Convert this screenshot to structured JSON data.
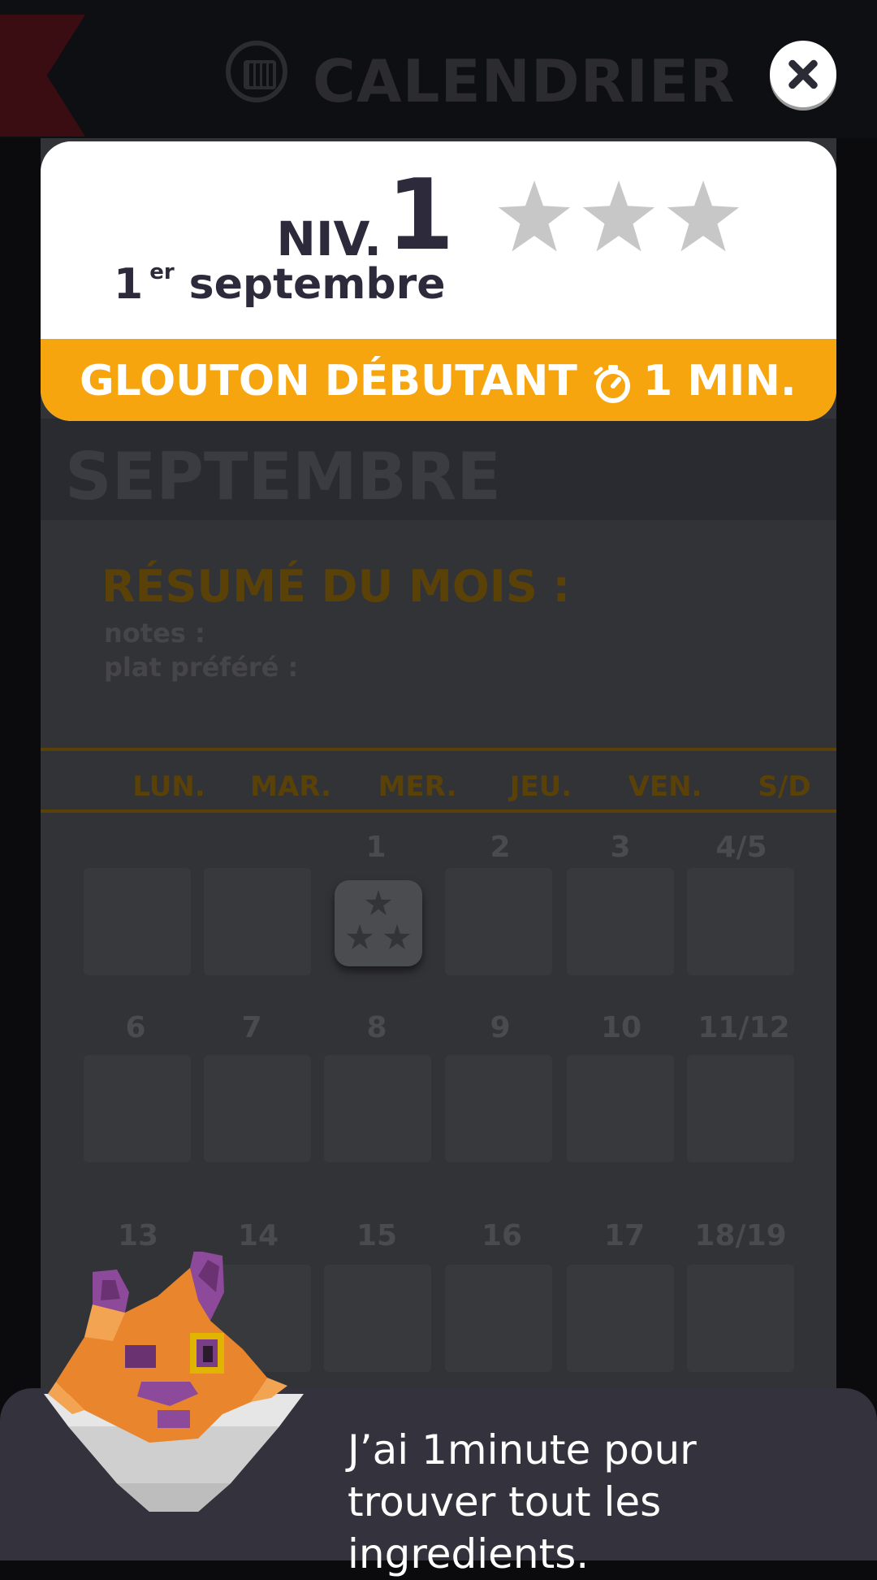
{
  "header": {
    "title": "CALENDRIER"
  },
  "calendar": {
    "month": "SEPTEMBRE",
    "summary_title": "RÉSUMÉ DU MOIS :",
    "notes_label": "notes :",
    "favorite_label": "plat préféré :",
    "weekdays": [
      "LUN.",
      "MAR.",
      "MER.",
      "JEU.",
      "VEN.",
      "S/D"
    ],
    "week1": [
      "",
      "",
      "1",
      "2",
      "3",
      "4/5"
    ],
    "week2": [
      "6",
      "7",
      "8",
      "9",
      "10",
      "11/12"
    ],
    "week3": [
      "13",
      "14",
      "15",
      "16",
      "17",
      "18/19"
    ]
  },
  "level_popup": {
    "level_prefix": "NIV.",
    "level_number": "1",
    "date_day": "1",
    "date_sup": "er",
    "date_month": "septembre",
    "stars_earned": 0,
    "stars_total": 3,
    "mode": "GLOUTON DÉBUTANT",
    "time": "1 MIN.",
    "accent_color": "#f7a50e"
  },
  "dialog": {
    "text": "J’ai 1minute pour trouver tout les ingredients."
  },
  "icons": [
    "back-ribbon-icon",
    "calendar-icon",
    "close-icon",
    "star-icon",
    "stopwatch-icon",
    "fox-mascot"
  ]
}
